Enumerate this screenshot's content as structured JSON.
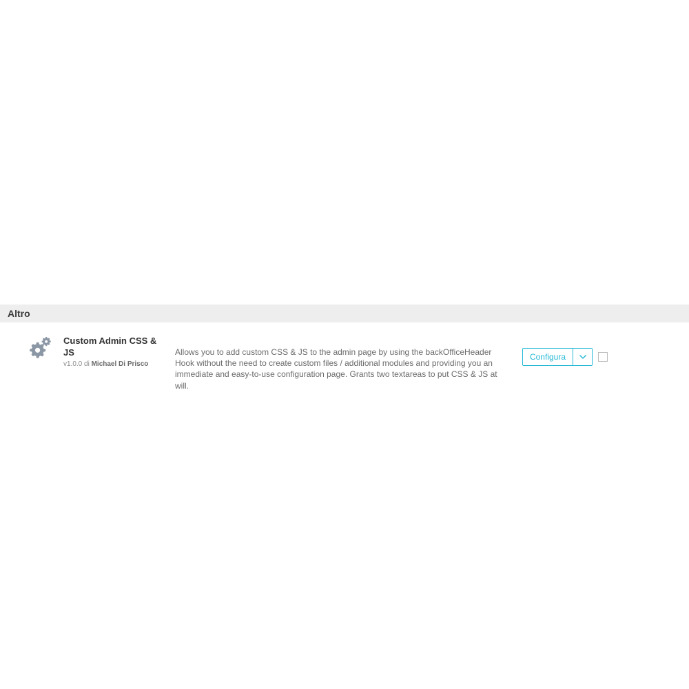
{
  "section": {
    "header": "Altro"
  },
  "module": {
    "title": "Custom Admin CSS & JS",
    "version_prefix": "v1.0.0 di ",
    "author": "Michael Di Prisco",
    "description": "Allows you to add custom CSS & JS to the admin page by using the backOfficeHeader Hook without the need to create custom files / additional modules and providing you an immediate and easy-to-use configuration page. Grants two textareas to put CSS & JS at will."
  },
  "actions": {
    "configure_label": "Configura"
  },
  "colors": {
    "accent": "#25b9d7",
    "icon_gray": "#8b97a5"
  }
}
